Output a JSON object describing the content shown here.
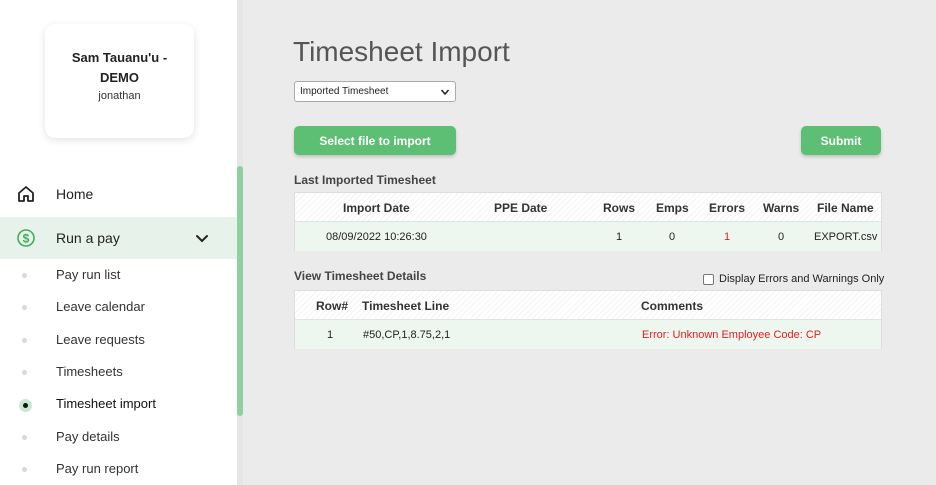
{
  "account": {
    "name": "Sam Tauanu'u - DEMO",
    "username": "jonathan"
  },
  "nav": {
    "home": "Home",
    "run_a_pay": "Run a pay",
    "sub_items": [
      "Pay run list",
      "Leave calendar",
      "Leave requests",
      "Timesheets",
      "Timesheet import",
      "Pay details",
      "Pay run report"
    ],
    "active_sub_item": "Timesheet import"
  },
  "page": {
    "title": "Timesheet Import",
    "import_type_selected": "Imported Timesheet",
    "select_file_label": "Select file to import",
    "submit_label": "Submit"
  },
  "last_imported": {
    "title": "Last Imported Timesheet",
    "columns": [
      "Import Date",
      "PPE Date",
      "Rows",
      "Emps",
      "Errors",
      "Warns",
      "File Name"
    ],
    "row": {
      "import_date": "08/09/2022 10:26:30",
      "ppe_date": "",
      "rows": "1",
      "emps": "0",
      "errors": "1",
      "warns": "0",
      "file_name": "EXPORT.csv"
    }
  },
  "details": {
    "title": "View Timesheet Details",
    "filter_label": "Display Errors and Warnings Only",
    "filter_checked": false,
    "columns": [
      "Row#",
      "Timesheet Line",
      "Comments"
    ],
    "row": {
      "row_num": "1",
      "line": "#50,CP,1,8.75,2,1",
      "comment": "Error: Unknown Employee Code: CP"
    }
  },
  "colors": {
    "accent": "#5cbf74",
    "error": "#e02020",
    "active_bg": "#e7f3ea"
  }
}
